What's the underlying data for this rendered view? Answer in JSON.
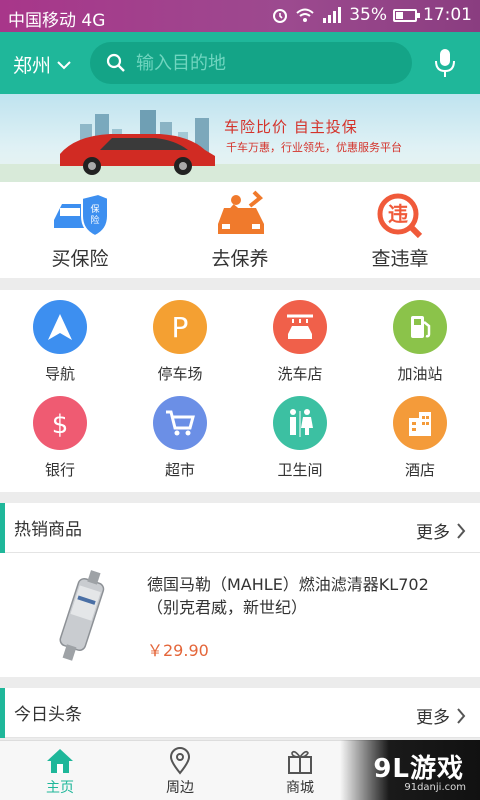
{
  "status_bar": {
    "carrier": "中国移动 4G",
    "battery": "35%",
    "time": "17:01"
  },
  "header": {
    "city": "郑州",
    "search_placeholder": "输入目的地"
  },
  "banner": {
    "headline": "车险比价 自主投保",
    "subline": "千车万惠，行业领先，优惠服务平台"
  },
  "quick_actions": [
    {
      "label": "买保险",
      "icon": "insurance-car-icon"
    },
    {
      "label": "去保养",
      "icon": "maintenance-icon"
    },
    {
      "label": "查违章",
      "icon": "violation-icon"
    }
  ],
  "services": [
    {
      "label": "导航",
      "icon": "navigation-icon",
      "color": "#3d8ff0"
    },
    {
      "label": "停车场",
      "icon": "parking-icon",
      "color": "#f4a032"
    },
    {
      "label": "洗车店",
      "icon": "carwash-icon",
      "color": "#f0604a"
    },
    {
      "label": "加油站",
      "icon": "gas-station-icon",
      "color": "#8bc34a"
    },
    {
      "label": "银行",
      "icon": "bank-icon",
      "color": "#ef5b72"
    },
    {
      "label": "超市",
      "icon": "cart-icon",
      "color": "#6b8fe6"
    },
    {
      "label": "卫生间",
      "icon": "restroom-icon",
      "color": "#3cc0a2"
    },
    {
      "label": "酒店",
      "icon": "hotel-icon",
      "color": "#f49b3a"
    }
  ],
  "hot_products": {
    "title": "热销商品",
    "more": "更多",
    "items": [
      {
        "name": "德国马勒（MAHLE）燃油滤清器KL702（别克君威，新世纪）",
        "price": "￥29.90"
      }
    ]
  },
  "headlines": {
    "title": "今日头条",
    "more": "更多"
  },
  "tabs": [
    {
      "label": "主页",
      "icon": "home-icon"
    },
    {
      "label": "周边",
      "icon": "location-pin-icon"
    },
    {
      "label": "商城",
      "icon": "gift-icon"
    }
  ],
  "watermark": {
    "brand": "9L游戏",
    "url": "91danji.com"
  },
  "colors": {
    "accent": "#1fb79a",
    "price": "#e4663a",
    "status_bar": "#a23b8a"
  }
}
